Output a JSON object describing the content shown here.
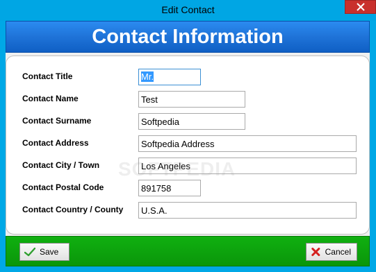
{
  "window": {
    "title": "Edit Contact"
  },
  "header": {
    "title": "Contact Information"
  },
  "form": {
    "fields": [
      {
        "label": "Contact Title",
        "value": "Mr."
      },
      {
        "label": "Contact Name",
        "value": "Test"
      },
      {
        "label": "Contact Surname",
        "value": "Softpedia"
      },
      {
        "label": "Contact Address",
        "value": "Softpedia Address"
      },
      {
        "label": "Contact City / Town",
        "value": "Los Angeles"
      },
      {
        "label": "Contact Postal Code",
        "value": "891758"
      },
      {
        "label": "Contact Country / County",
        "value": "U.S.A."
      }
    ]
  },
  "watermark": "SOFTPEDIA",
  "footer": {
    "save_label": "Save",
    "cancel_label": "Cancel"
  },
  "colors": {
    "titlebar": "#00a6e4",
    "header": "#1f73d8",
    "footer": "#0a960a",
    "close": "#c9302c"
  },
  "icons": {
    "close": "close-icon",
    "save": "checkmark-icon",
    "cancel": "red-x-icon"
  }
}
